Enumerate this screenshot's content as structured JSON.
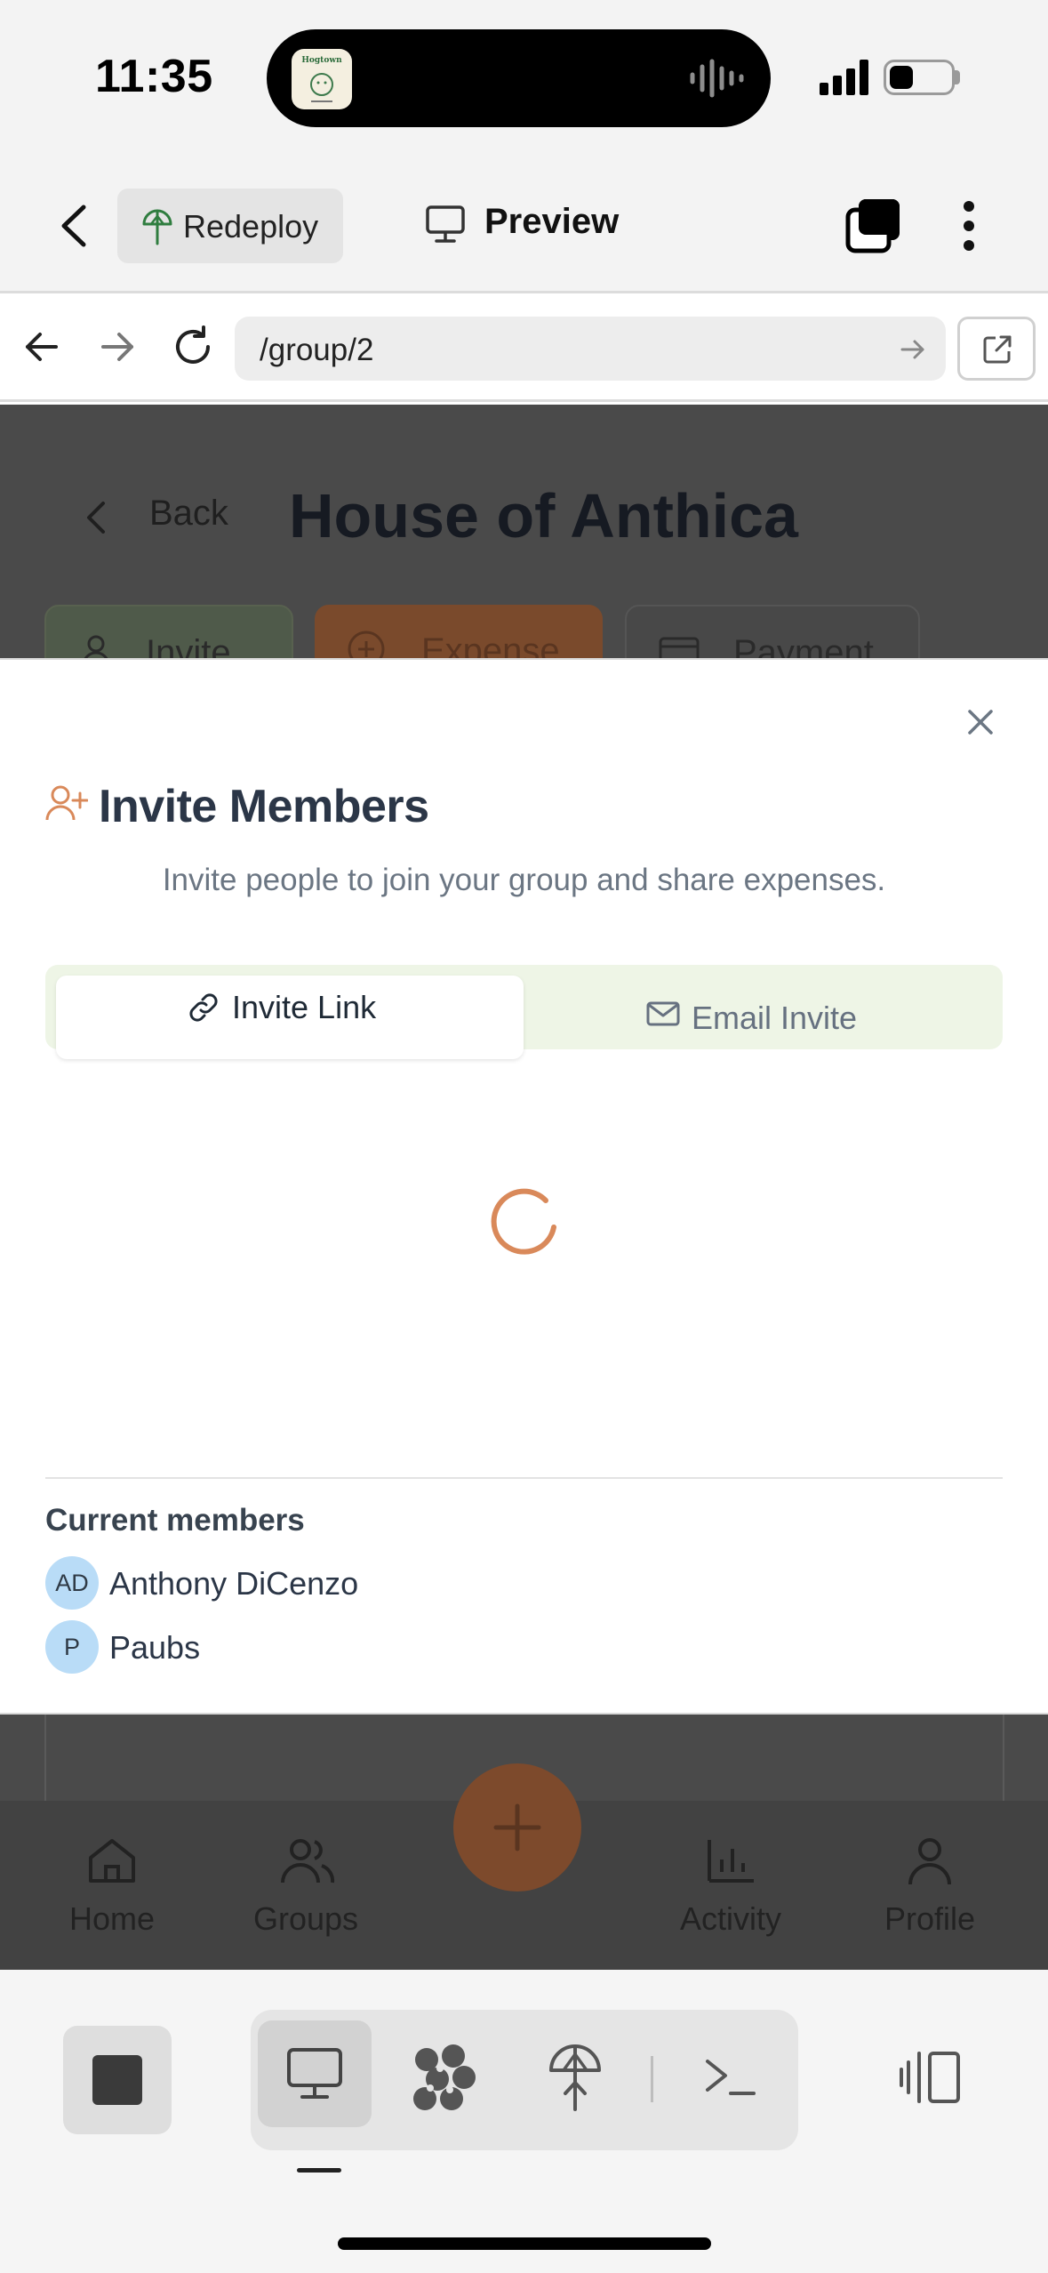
{
  "status_bar": {
    "time": "11:35",
    "app_badge": "Hogtown"
  },
  "app_bar": {
    "redeploy_label": "Redeploy",
    "preview_label": "Preview"
  },
  "browser": {
    "url": "/group/2"
  },
  "page": {
    "back_label": "Back",
    "title": "House of Anthica",
    "actions": [
      "Invite",
      "Expense",
      "Payment"
    ],
    "bottom_nav": [
      {
        "label": "Home",
        "icon": "home-icon"
      },
      {
        "label": "Groups",
        "icon": "users-icon"
      },
      {
        "label": "Activity",
        "icon": "chart-icon"
      },
      {
        "label": "Profile",
        "icon": "user-icon"
      }
    ]
  },
  "modal": {
    "title": "Invite Members",
    "subtitle": "Invite people to join your group and share expenses.",
    "tabs": [
      {
        "label": "Invite Link",
        "icon": "link-icon",
        "active": true
      },
      {
        "label": "Email Invite",
        "icon": "mail-icon",
        "active": false
      }
    ],
    "members_heading": "Current members",
    "members": [
      {
        "initials": "AD",
        "name": "Anthony DiCenzo"
      },
      {
        "initials": "P",
        "name": "Paubs"
      }
    ]
  },
  "colors": {
    "accent": "#d9895a",
    "title_text": "#2b3647",
    "avatar_bg": "#b9dcf7",
    "segment_bg": "#eef5e6"
  }
}
